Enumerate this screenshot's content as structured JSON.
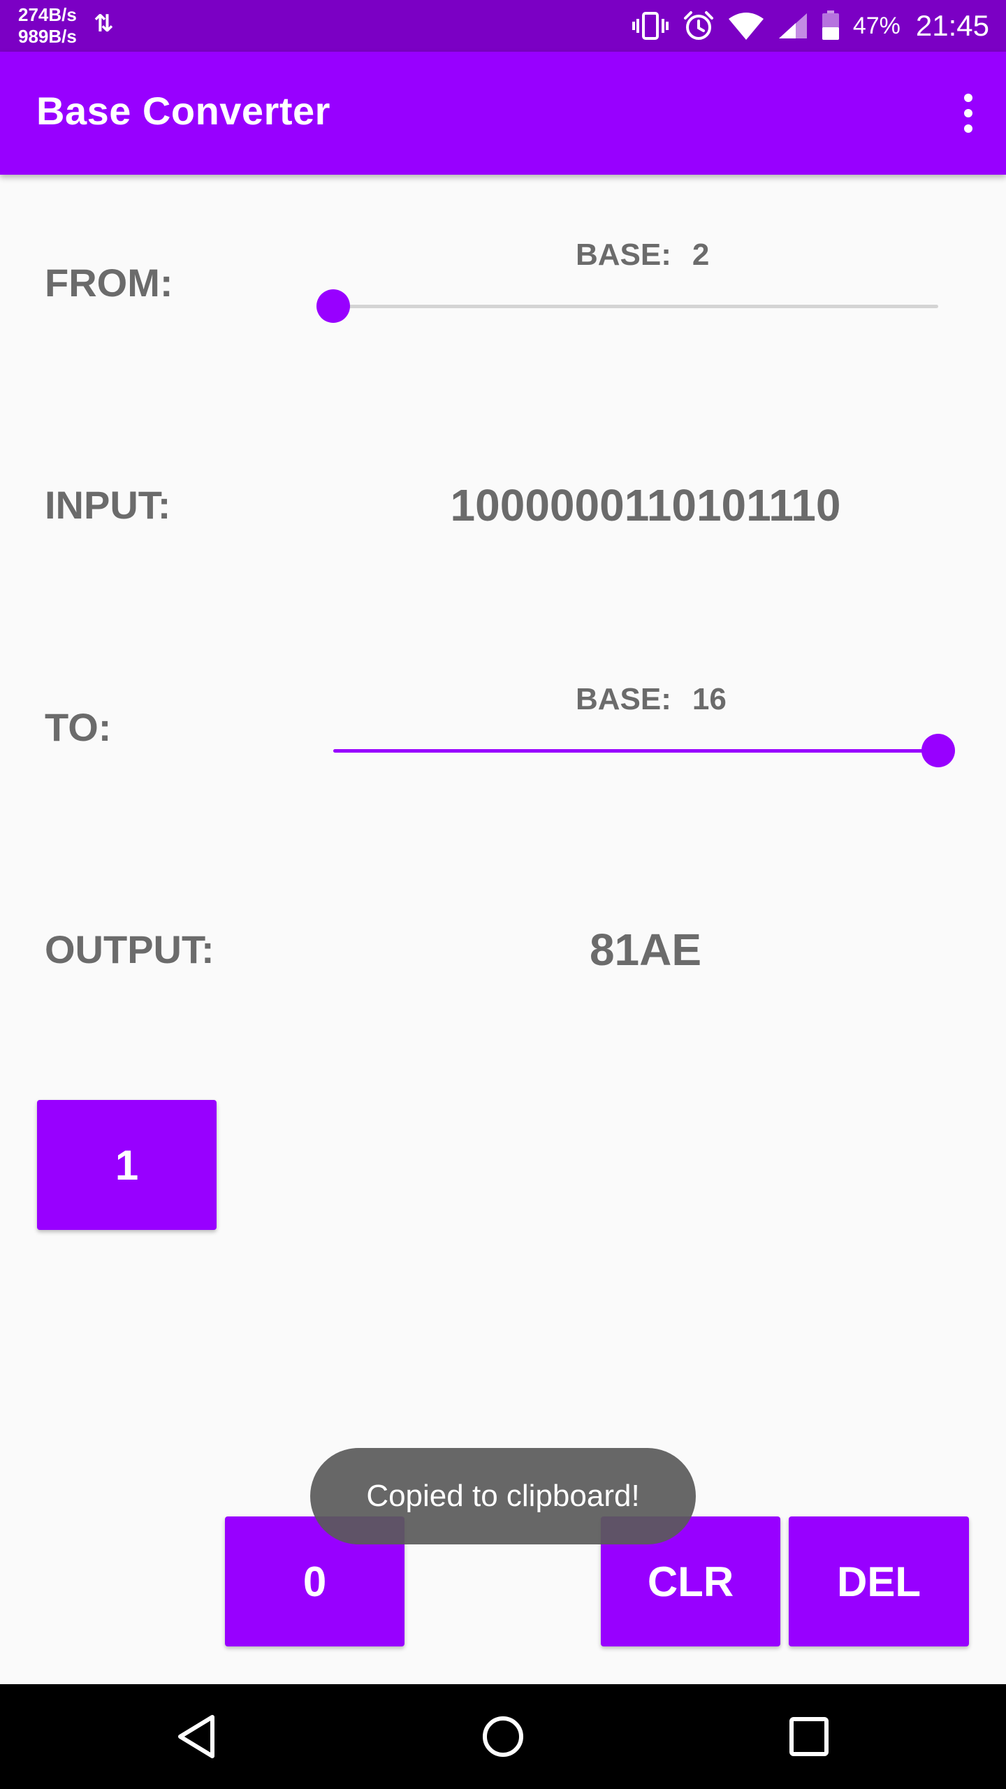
{
  "status_bar": {
    "upload_speed": "274B/s",
    "download_speed": "989B/s",
    "battery": "47%",
    "time": "21:45",
    "icons": [
      "data-transfer-icon",
      "vibrate-icon",
      "alarm-icon",
      "wifi-icon",
      "cell-signal-icon",
      "battery-icon"
    ]
  },
  "app_bar": {
    "title": "Base Converter",
    "menu_icon": "overflow-menu-icon"
  },
  "from": {
    "label": "FROM:",
    "base_label": "BASE:",
    "base_value": "2",
    "slider_fraction": 0.0
  },
  "input": {
    "label": "INPUT:",
    "value": "1000000110101110"
  },
  "to": {
    "label": "TO:",
    "base_label": "BASE:",
    "base_value": "16",
    "slider_fraction": 1.0
  },
  "output": {
    "label": "OUTPUT:",
    "value": "81AE"
  },
  "keypad": {
    "key_one": "1",
    "key_zero": "0",
    "clear": "CLR",
    "delete": "DEL"
  },
  "toast": {
    "message": "Copied to clipboard!"
  },
  "nav_bar": {
    "icons": [
      "back-icon",
      "home-icon",
      "recents-icon"
    ]
  },
  "colors": {
    "primary": "#9800ff",
    "primary_dark": "#7b00c4",
    "text_gray": "#6b6b6b",
    "background": "#fafafa"
  }
}
